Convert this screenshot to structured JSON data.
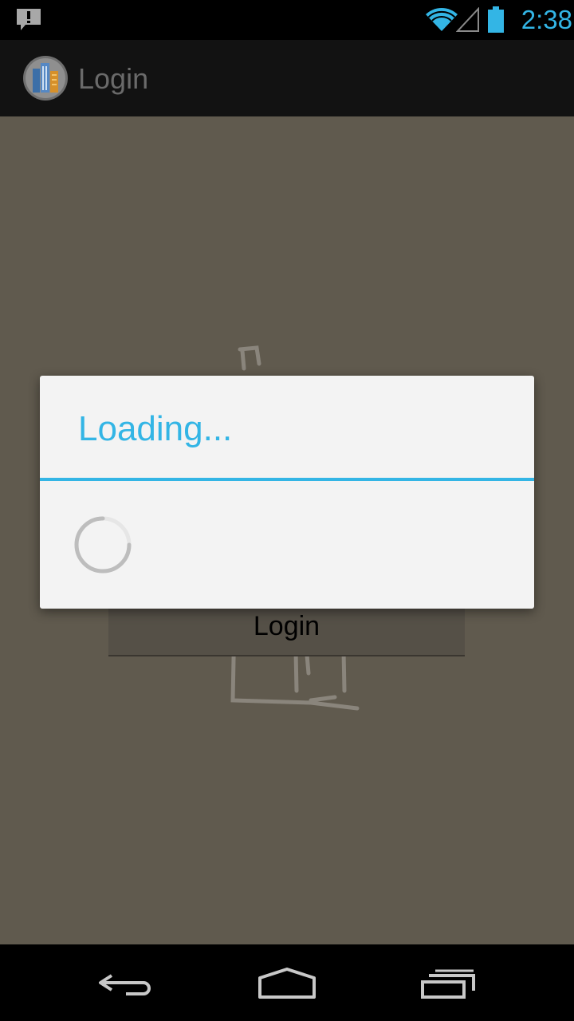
{
  "status_bar": {
    "time": "2:38",
    "notification_icon": "alert-notification-icon",
    "wifi_icon": "wifi-icon",
    "signal_icon": "cell-signal-icon",
    "battery_icon": "battery-icon",
    "accent": "#33b5e5"
  },
  "action_bar": {
    "title": "Login",
    "app_icon": "buildings-app-icon"
  },
  "content": {
    "login_button_label": "Login",
    "background_color": "#605a4e"
  },
  "dialog": {
    "title": "Loading...",
    "accent": "#33b5e5",
    "spinner_icon": "spinner-icon"
  },
  "nav_bar": {
    "back_icon": "back-icon",
    "home_icon": "home-icon",
    "recents_icon": "recents-icon"
  }
}
